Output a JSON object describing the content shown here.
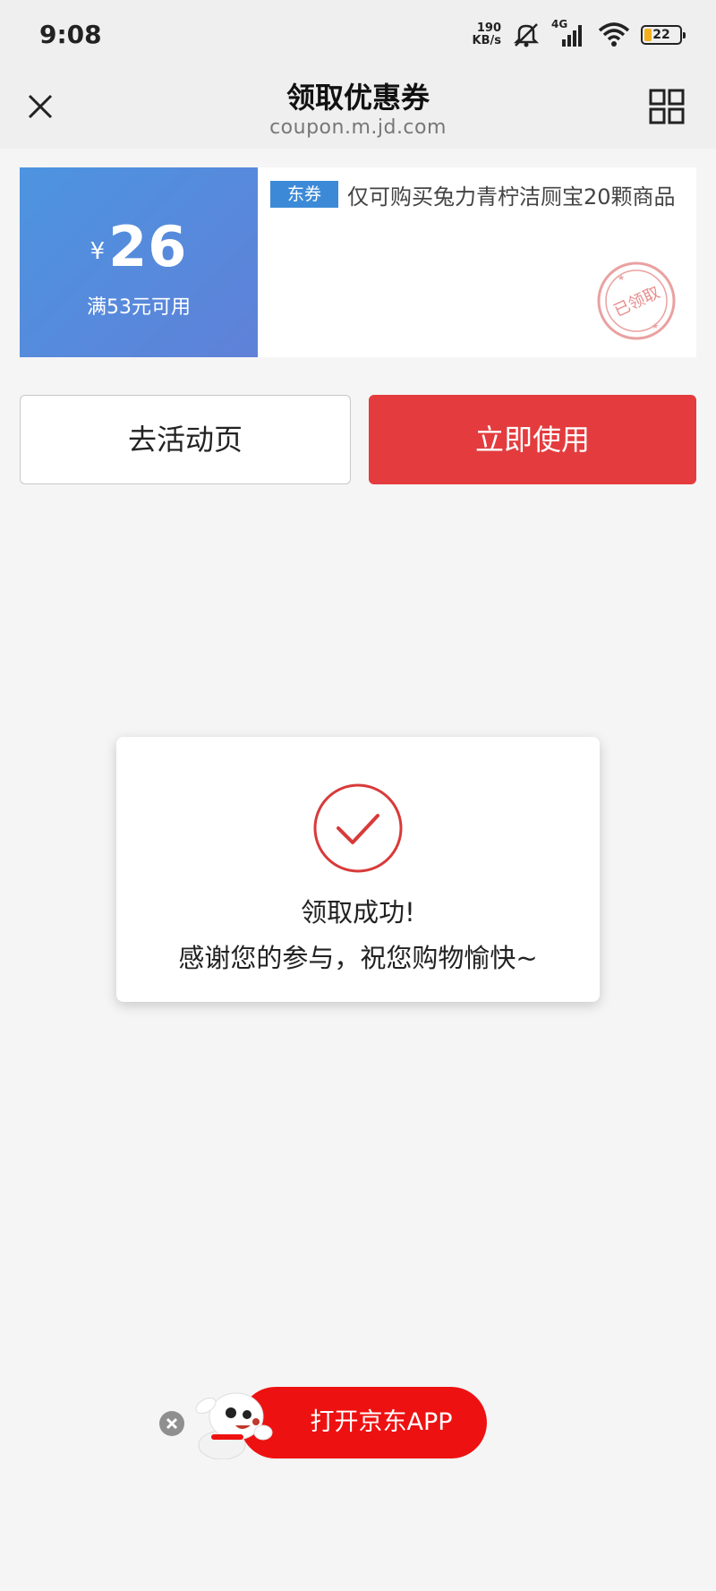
{
  "status_bar": {
    "time": "9:08",
    "net_speed_value": "190",
    "net_speed_unit": "KB/s",
    "network_type": "4G",
    "battery_level": "22",
    "icons": [
      "mute-icon",
      "signal-icon",
      "wifi-icon",
      "battery-icon"
    ]
  },
  "header": {
    "title": "领取优惠券",
    "url": "coupon.m.jd.com",
    "icons": [
      "close-icon",
      "grid-icon"
    ]
  },
  "coupon": {
    "currency": "¥",
    "amount": "26",
    "condition": "满53元可用",
    "tag": "东券",
    "description": "仅可购买兔力青柠洁厕宝20颗商品",
    "stamp_text": "已领取",
    "colors": {
      "left_bg": "#4d94e0",
      "tag_bg": "#3c8ad7",
      "stamp": "#e57a7a"
    }
  },
  "actions": {
    "activity_label": "去活动页",
    "use_label": "立即使用",
    "use_color": "#e43c3e"
  },
  "dialog": {
    "title": "领取成功!",
    "message": "感谢您的参与，祝您购物愉快~",
    "check_color": "#d83a3a"
  },
  "app_banner": {
    "label": "打开京东APP",
    "color": "#ee1111",
    "icons": [
      "close-icon",
      "mascot-icon"
    ]
  }
}
